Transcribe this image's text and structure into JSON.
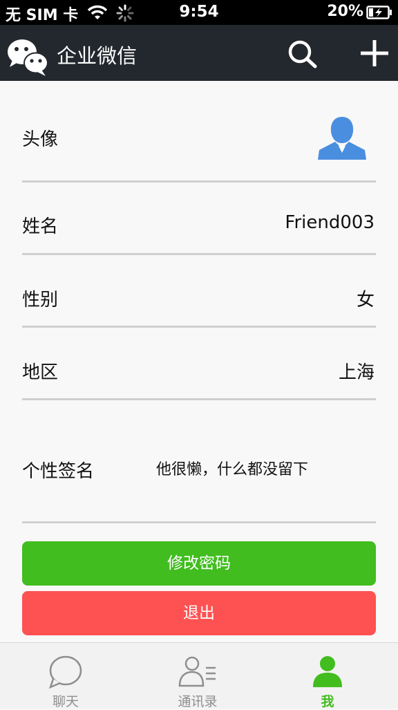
{
  "status_bar": {
    "carrier": "无 SIM 卡",
    "time": "9:54",
    "battery": "20%"
  },
  "header": {
    "title": "企业微信",
    "search_icon": "search-icon",
    "add_icon": "plus-icon"
  },
  "profile": {
    "avatar_label": "头像",
    "name_label": "姓名",
    "name_value": "Friend003",
    "gender_label": "性别",
    "gender_value": "女",
    "region_label": "地区",
    "region_value": "上海",
    "signature_label": "个性签名",
    "signature_value": "他很懒，什么都没留下"
  },
  "actions": {
    "change_password": "修改密码",
    "logout": "退出"
  },
  "tabs": [
    {
      "label": "聊天",
      "icon": "chat-bubble-icon"
    },
    {
      "label": "通讯录",
      "icon": "contacts-icon"
    },
    {
      "label": "我",
      "icon": "me-icon"
    }
  ],
  "colors": {
    "header_bg": "#23282e",
    "accent_green": "#41bd1f",
    "logout_red": "#fe5252",
    "avatar_blue": "#4a8ee0"
  }
}
